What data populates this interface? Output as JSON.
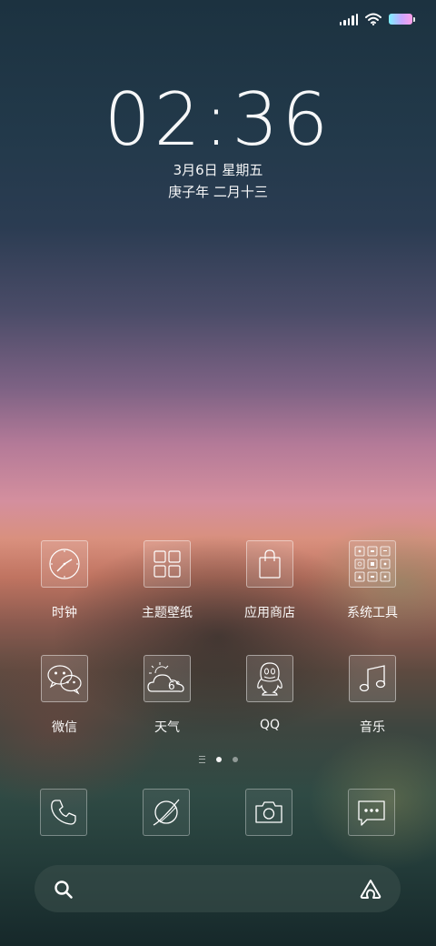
{
  "status_bar": {
    "icons": [
      "signal-icon",
      "wifi-icon",
      "battery-icon"
    ]
  },
  "lock": {
    "time": "02:36",
    "date": "3月6日 星期五",
    "lunar_date": "庚子年 二月十三"
  },
  "apps": [
    {
      "label": "时钟",
      "icon": "clock-icon"
    },
    {
      "label": "主题壁纸",
      "icon": "theme-icon"
    },
    {
      "label": "应用商店",
      "icon": "shopping-bag-icon"
    },
    {
      "label": "系统工具",
      "icon": "folder-grid-icon"
    },
    {
      "label": "微信",
      "icon": "wechat-icon"
    },
    {
      "label": "天气",
      "icon": "weather-icon",
      "temperature": "6°"
    },
    {
      "label": "QQ",
      "icon": "qq-penguin-icon"
    },
    {
      "label": "音乐",
      "icon": "music-note-icon"
    }
  ],
  "page_indicator": {
    "pages": 2,
    "active": 1
  },
  "dock": [
    {
      "icon": "phone-icon"
    },
    {
      "icon": "browser-icon"
    },
    {
      "icon": "camera-icon"
    },
    {
      "icon": "messages-icon"
    }
  ],
  "search": {
    "placeholder": "",
    "icon": "search-icon",
    "assistant_icon": "assistant-icon"
  }
}
